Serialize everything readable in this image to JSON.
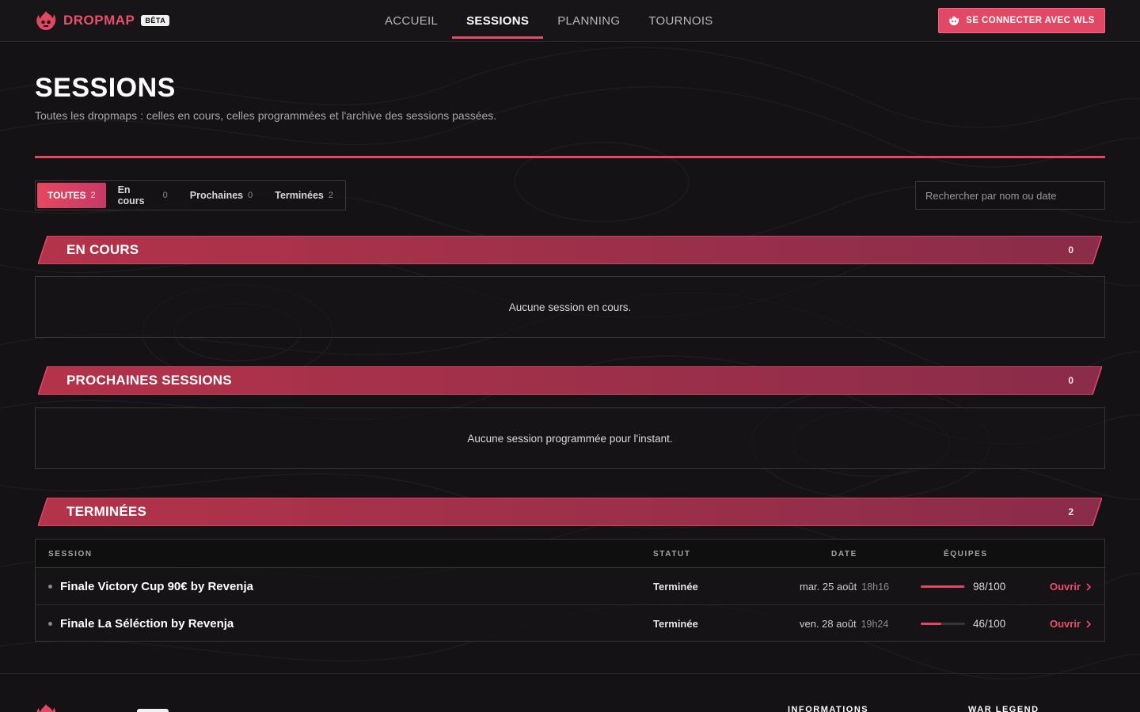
{
  "nav": {
    "brand": "DROPMAP",
    "beta": "BÊTA",
    "links": [
      "ACCUEIL",
      "SESSIONS",
      "PLANNING",
      "TOURNOIS"
    ],
    "active_link": "SESSIONS",
    "login_label": "SE CONNECTER AVEC WLS"
  },
  "hero": {
    "title": "SESSIONS",
    "subtitle": "Toutes les dropmaps : celles en cours, celles programmées et l'archive des sessions passées."
  },
  "filters": [
    {
      "label": "TOUTES",
      "count": "2",
      "active": true
    },
    {
      "label": "En cours",
      "count": "0",
      "active": false
    },
    {
      "label": "Prochaines",
      "count": "0",
      "active": false
    },
    {
      "label": "Terminées",
      "count": "2",
      "active": false
    }
  ],
  "search": {
    "placeholder": "Rechercher par nom ou date"
  },
  "sections": {
    "en_cours": {
      "title": "EN COURS",
      "count": "0",
      "empty": "Aucune session en cours."
    },
    "prochaines": {
      "title": "PROCHAINES SESSIONS",
      "count": "0",
      "empty": "Aucune session programmée pour l'instant."
    },
    "terminees": {
      "title": "TERMINÉES",
      "count": "2"
    }
  },
  "table": {
    "headers": {
      "session": "SESSION",
      "statut": "STATUT",
      "date": "DATE",
      "equipes": "ÉQUIPES"
    },
    "rows": [
      {
        "name": "Finale Victory Cup 90€ by Revenja",
        "status": "Terminée",
        "date": "mar. 25 août",
        "time": "18h16",
        "teams": "98/100",
        "teams_fraction": 0.98,
        "action": "Ouvrir"
      },
      {
        "name": "Finale La Séléction by Revenja",
        "status": "Terminée",
        "date": "ven. 28 août",
        "time": "19h24",
        "teams": "46/100",
        "teams_fraction": 0.46,
        "action": "Ouvrir"
      }
    ]
  },
  "footer": {
    "headings": [
      "INFORMATIONS",
      "WAR LEGEND"
    ]
  },
  "colors": {
    "accent": "#e24763",
    "background": "#141214",
    "banner_start": "#b3334a",
    "banner_end": "#8a2c4a"
  }
}
